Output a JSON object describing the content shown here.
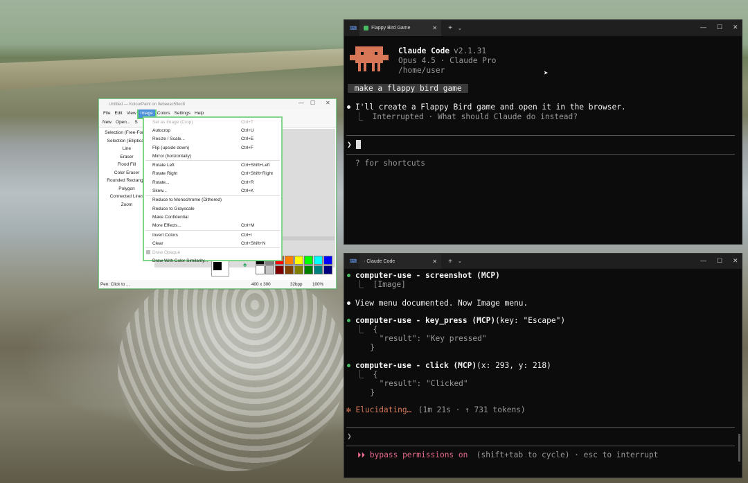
{
  "kolourpaint": {
    "title": "Untitled — KolourPaint on 0ebeeac59ec8",
    "menus": [
      "File",
      "Edit",
      "View",
      "Image",
      "Colors",
      "Settings",
      "Help"
    ],
    "toolbar": [
      "New",
      "Open...",
      "S"
    ],
    "tools": [
      "Selection (Free-Form)",
      "Selection (Elliptical)",
      "Line",
      "Eraser",
      "Flood Fill",
      "Color Eraser",
      "Rounded Rectangle",
      "Polygon",
      "Connected Lines",
      "Zoom"
    ],
    "status": {
      "left": "Pen: Click to ...",
      "size": "400 x 300",
      "depth": "32bpp",
      "zoom": "100%"
    },
    "palette": [
      "#000000",
      "#7f7f7f",
      "#ff0000",
      "#ff7f00",
      "#ffff00",
      "#00ff00",
      "#00ffff",
      "#0000ff",
      "#ffffff",
      "#c3c3c3",
      "#7f0000",
      "#7f3f00",
      "#7f7f00",
      "#007f00",
      "#007f7f",
      "#00007f"
    ]
  },
  "image_menu": [
    {
      "label": "Set as Image (Crop)",
      "shortcut": "Ctrl+T",
      "disabled": true
    },
    {
      "label": "Autocrop",
      "shortcut": "Ctrl+U"
    },
    {
      "label": "Resize / Scale...",
      "shortcut": "Ctrl+E"
    },
    {
      "label": "Flip (upside down)",
      "shortcut": "Ctrl+F"
    },
    {
      "label": "Mirror (horizontally)",
      "shortcut": ""
    },
    {
      "sep": true
    },
    {
      "label": "Rotate Left",
      "shortcut": "Ctrl+Shift+Left"
    },
    {
      "label": "Rotate Right",
      "shortcut": "Ctrl+Shift+Right"
    },
    {
      "label": "Rotate...",
      "shortcut": "Ctrl+R"
    },
    {
      "label": "Skew...",
      "shortcut": "Ctrl+K"
    },
    {
      "sep": true
    },
    {
      "label": "Reduce to Monochrome (Dithered)",
      "shortcut": ""
    },
    {
      "label": "Reduce to Grayscale",
      "shortcut": ""
    },
    {
      "label": "Make Confidential",
      "shortcut": ""
    },
    {
      "label": "More Effects...",
      "shortcut": "Ctrl+M"
    },
    {
      "sep": true
    },
    {
      "label": "Invert Colors",
      "shortcut": "Ctrl+I"
    },
    {
      "label": "Clear",
      "shortcut": "Ctrl+Shift+N"
    },
    {
      "sep": true
    },
    {
      "label": "Draw Opaque",
      "shortcut": "",
      "disabled": true,
      "check": true
    },
    {
      "label": "Draw With Color Similarity...",
      "shortcut": ""
    }
  ],
  "term1": {
    "tab": "Flappy Bird Game",
    "app": "Claude Code",
    "version": "v2.1.31",
    "model": "Opus 4.5 · Claude Pro",
    "cwd": "/home/user",
    "prompt": " make a flappy bird game ",
    "reply": "I'll create a Flappy Bird game and open it in the browser.",
    "interrupted": "⎿  Interrupted · What should Claude do instead?",
    "hint": "? for shortcuts",
    "caret": "❯"
  },
  "term2": {
    "tab": "· Claude Code",
    "lines": [
      {
        "t": "computer-use - screenshot (MCP)",
        "dot": true
      },
      {
        "t": "⎿  [Image]"
      },
      {
        "t": "View menu documented. Now Image menu.",
        "dot": true,
        "white": true
      },
      {
        "t": "computer-use - key_press (MCP)",
        "args": "(key: \"Escape\")",
        "dot": true
      },
      {
        "t": "⎿  {"
      },
      {
        "t": "     \"result\": \"Key pressed\""
      },
      {
        "t": "   }"
      },
      {
        "t": "computer-use - click (MCP)",
        "args": "(x: 293, y: 218)",
        "dot": true
      },
      {
        "t": "⎿  {"
      },
      {
        "t": "     \"result\": \"Clicked\""
      },
      {
        "t": "   }"
      }
    ],
    "status": "✻ Elucidating…",
    "status_meta": " (1m 21s · ↑ 731 tokens)",
    "caret": "❯",
    "mode": "⏵⏵ bypass permissions on",
    "mode_meta": " (shift+tab to cycle) · esc to interrupt"
  },
  "colors": {
    "accent": "#d77757",
    "green": "#4eba65",
    "bypass": "#e86a8c"
  }
}
